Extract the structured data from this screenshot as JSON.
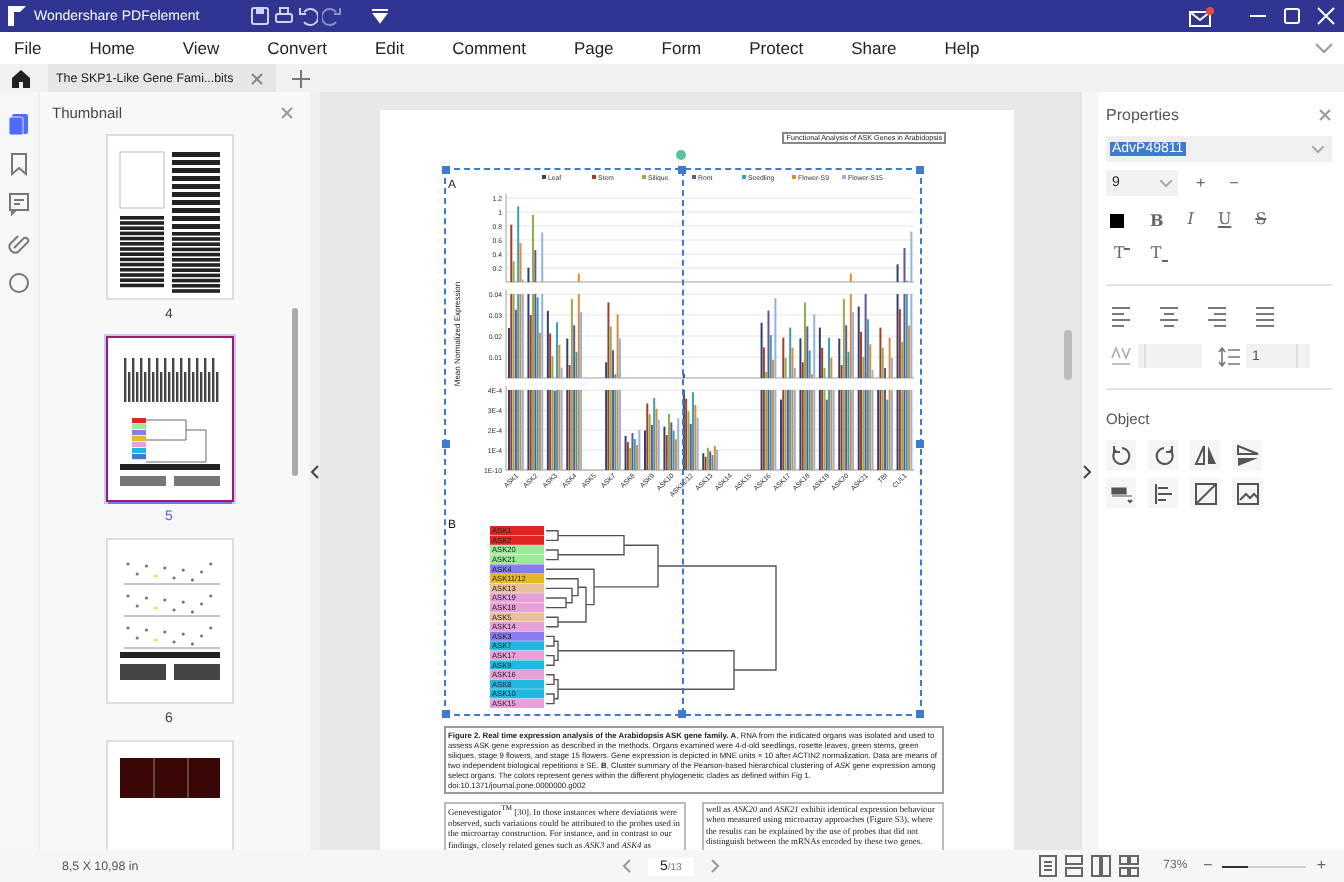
{
  "window": {
    "app_name": "Wondershare PDFelement"
  },
  "menu": [
    {
      "label": "File"
    },
    {
      "label": "Home"
    },
    {
      "label": "View"
    },
    {
      "label": "Convert"
    },
    {
      "label": "Edit"
    },
    {
      "label": "Comment"
    },
    {
      "label": "Page"
    },
    {
      "label": "Form"
    },
    {
      "label": "Protect"
    },
    {
      "label": "Share"
    },
    {
      "label": "Help"
    }
  ],
  "document_tab": {
    "title": "The SKP1-Like Gene Fami...bits"
  },
  "side_icons": [
    {
      "kind": "pages",
      "selected": true
    },
    {
      "kind": "bookmark",
      "selected": false
    },
    {
      "kind": "comment",
      "selected": false
    },
    {
      "kind": "attachment",
      "selected": false
    },
    {
      "kind": "circle",
      "selected": false
    }
  ],
  "thumbnail_panel": {
    "title": "Thumbnail",
    "pages": [
      {
        "kind": "text",
        "label": "4",
        "selected": false
      },
      {
        "kind": "chart",
        "label": "5",
        "selected": true
      },
      {
        "kind": "scatter",
        "label": "6",
        "selected": false
      },
      {
        "kind": "images",
        "selected": false
      }
    ]
  },
  "page": {
    "header": "Functional Analysis of ASK Genes in Arabidopsis",
    "figure": {
      "panel_a": "A",
      "panel_b": "B",
      "y_label": "Mean Normalized Expression",
      "legend": [
        {
          "name": "Leaf",
          "color": "#34406e"
        },
        {
          "name": "Stem",
          "color": "#a0402c"
        },
        {
          "name": "Silique",
          "color": "#8fae4c"
        },
        {
          "name": "Root",
          "color": "#6c5490"
        },
        {
          "name": "Seedling",
          "color": "#3aa0b0"
        },
        {
          "name": "Flower-S9",
          "color": "#e08a40"
        },
        {
          "name": "Flower-S15",
          "color": "#94b4dc"
        }
      ],
      "y_axis_sections": [
        {
          "ticks": [
            "1.2",
            "1",
            "0.8",
            "0.6",
            "0.4",
            "0.2"
          ]
        },
        {
          "ticks": [
            "0.04",
            "0.03",
            "0.02",
            "0.01"
          ]
        },
        {
          "ticks": [
            "4E-4",
            "3E-4",
            "2E-4",
            "1E-4",
            "1E-10"
          ]
        }
      ],
      "categories": [
        "ASK1",
        "ASK2",
        "ASK3",
        "ASK4",
        "ASK5",
        "ASK7",
        "ASK8",
        "ASK9",
        "ASK10",
        "ASK11/12",
        "ASK13",
        "ASK14",
        "ASK15",
        "ASK16",
        "ASK17",
        "ASK18",
        "ASK19",
        "ASK20",
        "ASK21",
        "TBI",
        "CUL1"
      ],
      "dendrogram_leaves": [
        {
          "label": "ASK1",
          "color": "#e02424"
        },
        {
          "label": "ASK2",
          "color": "#e02424"
        },
        {
          "label": "ASK20",
          "color": "#9ee89a"
        },
        {
          "label": "ASK21",
          "color": "#9ee89a"
        },
        {
          "label": "ASK4",
          "color": "#8a7cf0"
        },
        {
          "label": "ASK11/12",
          "color": "#e8b820"
        },
        {
          "label": "ASK13",
          "color": "#e8c09c"
        },
        {
          "label": "ASK19",
          "color": "#e8a0d8"
        },
        {
          "label": "ASK18",
          "color": "#e8a0d8"
        },
        {
          "label": "ASK5",
          "color": "#e8c09c"
        },
        {
          "label": "ASK14",
          "color": "#e8a0d8"
        },
        {
          "label": "ASK3",
          "color": "#8a7cf0"
        },
        {
          "label": "ASK7",
          "color": "#20b8e0"
        },
        {
          "label": "ASK17",
          "color": "#e8a0d8"
        },
        {
          "label": "ASK9",
          "color": "#20b8e0"
        },
        {
          "label": "ASK16",
          "color": "#e8a0d8"
        },
        {
          "label": "ASK8",
          "color": "#20b8e0"
        },
        {
          "label": "ASK10",
          "color": "#20b8e0"
        },
        {
          "label": "ASK15",
          "color": "#e8a0d8"
        }
      ]
    },
    "caption": "**Figure 2. Real time expression analysis of the Arabidopsis ASK gene family.** **A**, RNA from the indicated organs was isolated and used to assess ASK gene expression as described in the methods. Organs examined were 4-d-old seedlings, rosette leaves, green stems, green siliques, stage 9 flowers, and stage 15 flowers. Gene expression is depicted in MNE units × 10 after ACTIN2 normalization. Data are means of two independent biological repetitions ± SE. **B**, Cluster summary of the Pearson-based hierarchical clustering of *ASK* gene expression among select organs. The colors represent genes within the different phylogenetic clades as defined within Fig 1. doi:10.1371/journal.pone.0000000.g002",
    "body_columns": [
      "Genevestigator$^{TM}$ [30]. In those instances where deviations were observed, such variations could be attributed to the probes used in the microarray construction. For instance, and in contrast to our findings, closely related genes such as *ASK3* and *ASK4* as",
      "well as *ASK20* and *ASK21* exhibit identical expression behaviour when measured using microarray approaches (Figure S3), where the results can be explained by the use of probes that did not distinguish between the mRNAs encoded by these two genes."
    ]
  },
  "properties": {
    "title": "Properties",
    "font": "AdvP49811",
    "font_size": "9",
    "size_plus": "+",
    "size_minus": "−",
    "format_buttons": [
      {
        "kind": "bold",
        "label": "B"
      },
      {
        "kind": "italic",
        "label": "I"
      },
      {
        "kind": "underline",
        "label": "U"
      },
      {
        "kind": "strike",
        "label": "S"
      }
    ],
    "script_buttons": [
      {
        "kind": "superscript",
        "label": "T"
      },
      {
        "kind": "subscript",
        "label": "T"
      }
    ],
    "line_spacing": "1",
    "object_heading": "Object"
  },
  "status_bar": {
    "page_size": "8,5 X 10,98 in",
    "current_page": "5",
    "page_count": "/13",
    "zoom": "73%",
    "zoom_minus": "−",
    "zoom_plus": "+",
    "zoom_slider": {
      "level": 0.3
    }
  }
}
